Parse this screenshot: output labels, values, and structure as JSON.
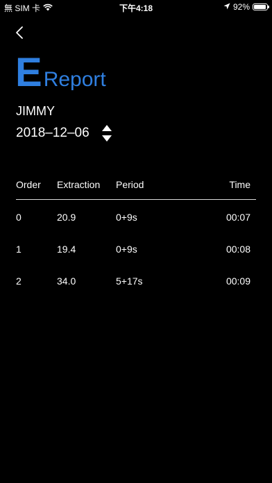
{
  "status_bar": {
    "carrier": "無 SIM 卡",
    "time": "下午4:18",
    "battery_percent": "92%",
    "battery_level": 0.92
  },
  "header": {
    "title_letter": "E",
    "title_word": "Report"
  },
  "report": {
    "name": "JIMMY",
    "date": "2018–12–06"
  },
  "table": {
    "columns": [
      "Order",
      "Extraction",
      "Period",
      "Time"
    ],
    "rows": [
      {
        "order": "0",
        "extraction": "20.9",
        "period": "0+9s",
        "time": "00:07"
      },
      {
        "order": "1",
        "extraction": "19.4",
        "period": "0+9s",
        "time": "00:08"
      },
      {
        "order": "2",
        "extraction": "34.0",
        "period": "5+17s",
        "time": "00:09"
      }
    ]
  },
  "colors": {
    "accent": "#2f7fe0",
    "background": "#000000",
    "text": "#ffffff"
  },
  "icons": [
    "wifi-icon",
    "location-arrow-icon",
    "battery-icon",
    "back-chevron-icon",
    "triangle-up-icon",
    "triangle-down-icon"
  ]
}
